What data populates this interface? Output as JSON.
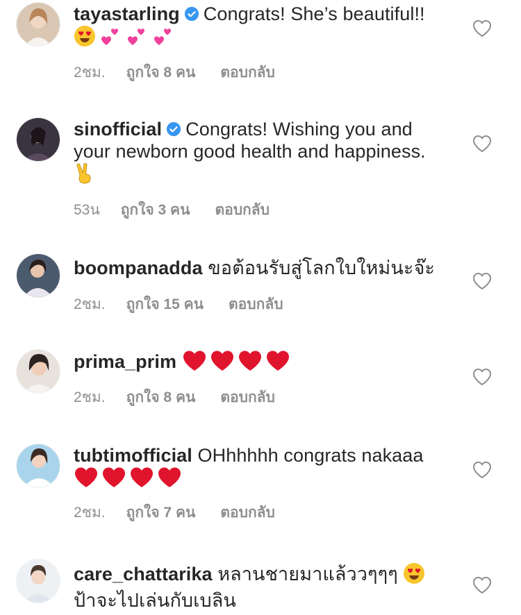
{
  "comments": [
    {
      "username": "tayastarling",
      "verified": true,
      "text": "Congrats! She’s beautiful!!",
      "emojis": [
        "heart-eyes-emoji",
        "pink-hearts-emoji",
        "pink-hearts-emoji",
        "pink-hearts-emoji"
      ],
      "time": "2ชม.",
      "likes": "ถูกใจ 8 คน",
      "reply": "ตอบกลับ"
    },
    {
      "username": "sinofficial",
      "verified": true,
      "text": "Congrats! Wishing you and your newborn good health and happiness.",
      "emojis": [
        "victory-hand-emoji"
      ],
      "time": "53น",
      "likes": "ถูกใจ 3 คน",
      "reply": "ตอบกลับ"
    },
    {
      "username": "boompanadda",
      "verified": false,
      "text": "ขอต้อนรับสู่โลกใบใหม่นะจ๊ะ",
      "emojis": [],
      "time": "2ชม.",
      "likes": "ถูกใจ 15 คน",
      "reply": "ตอบกลับ"
    },
    {
      "username": "prima_prim",
      "verified": false,
      "text": "",
      "emojis": [
        "red-heart-emoji",
        "red-heart-emoji",
        "red-heart-emoji",
        "red-heart-emoji"
      ],
      "time": "2ชม.",
      "likes": "ถูกใจ 8 คน",
      "reply": "ตอบกลับ"
    },
    {
      "username": "tubtimofficial",
      "verified": false,
      "text": "OHhhhhh congrats nakaaa",
      "emojis": [
        "red-heart-emoji",
        "red-heart-emoji",
        "red-heart-emoji",
        "red-heart-emoji"
      ],
      "time": "2ชม.",
      "likes": "ถูกใจ 7 คน",
      "reply": "ตอบกลับ"
    },
    {
      "username": "care_chattarika",
      "verified": false,
      "text": "หลานชายมาแล้ววๆๆๆ",
      "text2": "ป้าจะไปเล่นกับเบลิน",
      "emojis": [
        "heart-eyes-emoji"
      ],
      "time": "",
      "likes": "",
      "reply": ""
    }
  ],
  "colors": {
    "text": "#262626",
    "meta": "#8e8e8e",
    "verified": "#3897f0",
    "red_heart": "#e0142c",
    "pink_heart": "#f0429c"
  }
}
